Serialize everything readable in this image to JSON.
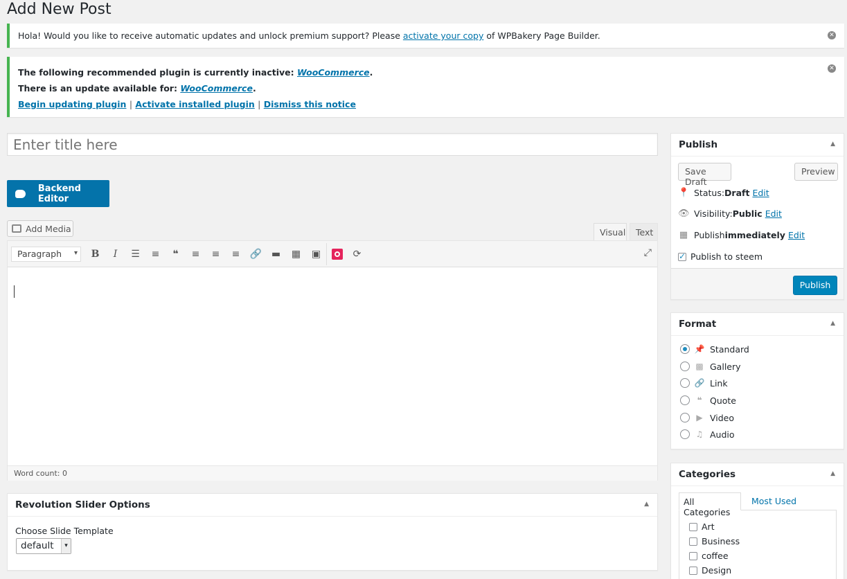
{
  "page": {
    "title": "Add New Post"
  },
  "notice1": {
    "text_before": "Hola! Would you like to receive automatic updates and unlock premium support? Please ",
    "link": "activate your copy",
    "text_after": " of WPBakery Page Builder."
  },
  "notice2": {
    "line1_text": "The following recommended plugin is currently inactive: ",
    "line1_link": "WooCommerce",
    "line2_text": "There is an update available for: ",
    "line2_link": "WooCommerce",
    "actions": [
      "Begin updating plugin",
      "Activate installed plugin",
      "Dismiss this notice"
    ],
    "separator": "|"
  },
  "title_field": {
    "placeholder": "Enter title here"
  },
  "backend_editor": {
    "label": "Backend Editor"
  },
  "editor": {
    "add_media_label": "Add Media",
    "tabs": {
      "visual": "Visual",
      "text": "Text"
    },
    "format_select": "Paragraph",
    "word_count": "Word count: 0"
  },
  "revolution": {
    "title": "Revolution Slider Options",
    "label": "Choose Slide Template",
    "select_value": "default"
  },
  "publish": {
    "title": "Publish",
    "save_draft": "Save Draft",
    "preview": "Preview",
    "status_label": "Status: ",
    "status_value": "Draft",
    "visibility_label": "Visibility: ",
    "visibility_value": "Public",
    "publish_label": "Publish ",
    "publish_value": "immediately",
    "edit": "Edit",
    "steem_label": "Publish to steem",
    "publish_button": "Publish"
  },
  "format": {
    "title": "Format",
    "options": [
      "Standard",
      "Gallery",
      "Link",
      "Quote",
      "Video",
      "Audio"
    ]
  },
  "categories": {
    "title": "Categories",
    "tab_all": "All Categories",
    "tab_most": "Most Used",
    "items": [
      "Art",
      "Business",
      "coffee",
      "Design"
    ]
  }
}
